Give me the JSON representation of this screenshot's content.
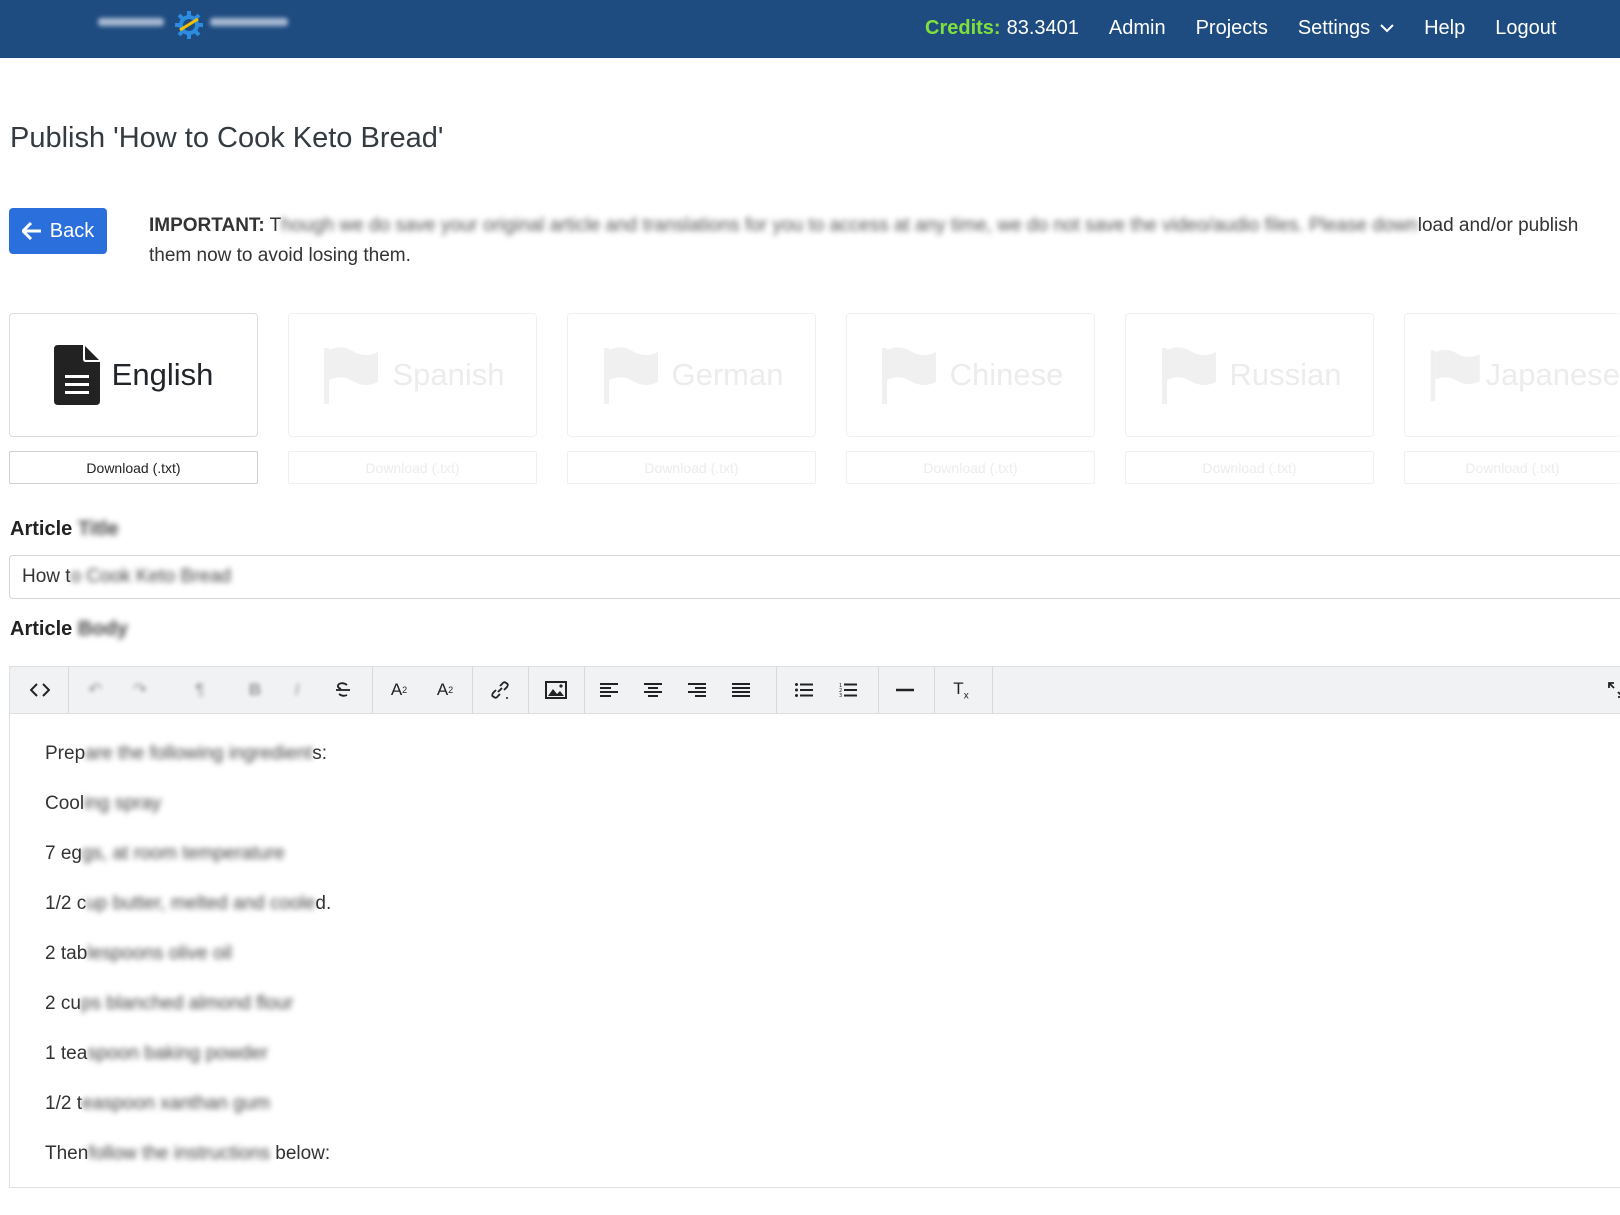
{
  "nav": {
    "credits_label": "Credits:",
    "credits_value": "83.3401",
    "admin": "Admin",
    "projects": "Projects",
    "settings": "Settings",
    "help": "Help",
    "logout": "Logout"
  },
  "page": {
    "title": "Publish 'How to Cook Keto Bread'",
    "back_label": "Back",
    "notice_strong": "IMPORTANT:",
    "notice_start": " T",
    "notice_blurred": "hough we do save your original article and translations for you to access at any time, we do not save the video/audio files. Please down",
    "notice_end": "load and/or publish them now to avoid losing them."
  },
  "languages": [
    {
      "name": "English",
      "download": "Download (.txt)",
      "active": true
    },
    {
      "name": "Spanish",
      "download": "Download (.txt)",
      "active": false
    },
    {
      "name": "German",
      "download": "Download (.txt)",
      "active": false
    },
    {
      "name": "Chinese",
      "download": "Download (.txt)",
      "active": false
    },
    {
      "name": "Russian",
      "download": "Download (.txt)",
      "active": false
    },
    {
      "name": "Japanese",
      "download": "Download (.txt)",
      "active": false
    }
  ],
  "article": {
    "title_label": "Article",
    "title_label_blurred": "Title",
    "title_visible": "How t",
    "title_blurred": "o Cook Keto Bread",
    "body_label": "Article",
    "body_label_blurred": "Body"
  },
  "body_lines": [
    {
      "visible": "Prep",
      "blurred": "are the following ingredient",
      "end": "s:"
    },
    {
      "visible": "Cool",
      "blurred": "ing spray",
      "end": ""
    },
    {
      "visible": "7 eg",
      "blurred": "gs, at room temperature",
      "end": ""
    },
    {
      "visible": "1/2 c",
      "blurred": "up butter, melted and coole",
      "end": "d."
    },
    {
      "visible": "2 tab",
      "blurred": "lespoons olive oil",
      "end": ""
    },
    {
      "visible": "2 cu",
      "blurred": "ps blanched almond flour",
      "end": ""
    },
    {
      "visible": "1 tea",
      "blurred": "spoon baking powder",
      "end": ""
    },
    {
      "visible": "1/2 t",
      "blurred": "easpoon xanthan gum",
      "end": ""
    },
    {
      "visible": "Then",
      "blurred": " follow the instructions",
      "end": " below:"
    }
  ],
  "colors": {
    "navbar": "#1e4b80",
    "credits": "#7ee03a",
    "primary": "#2a6fdb"
  }
}
